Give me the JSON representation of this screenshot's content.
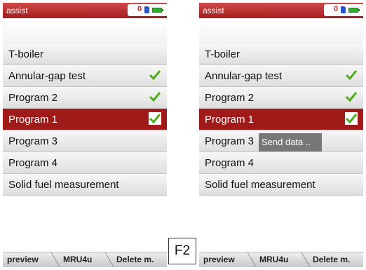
{
  "screens": [
    {
      "status": {
        "title": "assist",
        "count": "0"
      },
      "menu": [
        {
          "label": "T-boiler",
          "checked": false,
          "selected": false
        },
        {
          "label": "Annular-gap test",
          "checked": true,
          "selected": false
        },
        {
          "label": "Program 2",
          "checked": true,
          "selected": false
        },
        {
          "label": "Program 1",
          "checked": true,
          "selected": true
        },
        {
          "label": "Program 3",
          "checked": false,
          "selected": false
        },
        {
          "label": "Program 4",
          "checked": false,
          "selected": false
        },
        {
          "label": "Solid fuel measurement",
          "checked": false,
          "selected": false
        }
      ],
      "softkeys": [
        "preview",
        "MRU4u",
        "Delete m."
      ]
    },
    {
      "status": {
        "title": "assist",
        "count": "0"
      },
      "menu": [
        {
          "label": "T-boiler",
          "checked": false,
          "selected": false
        },
        {
          "label": "Annular-gap test",
          "checked": true,
          "selected": false
        },
        {
          "label": "Program 2",
          "checked": true,
          "selected": false
        },
        {
          "label": "Program 1",
          "checked": true,
          "selected": true
        },
        {
          "label": "Program 3",
          "checked": false,
          "selected": false
        },
        {
          "label": "Program 4",
          "checked": false,
          "selected": false
        },
        {
          "label": "Solid fuel measurement",
          "checked": false,
          "selected": false
        }
      ],
      "tooltip": "Send data ..",
      "softkeys": [
        "preview",
        "MRU4u",
        "Delete m."
      ]
    }
  ],
  "key_label": "F2",
  "icons": {
    "check": "check-icon",
    "sd_card": "sd-card-icon",
    "battery": "battery-icon"
  },
  "colors": {
    "accent": "#a01a1a",
    "check": "#4caf1a",
    "tooltip_bg": "#777777"
  }
}
